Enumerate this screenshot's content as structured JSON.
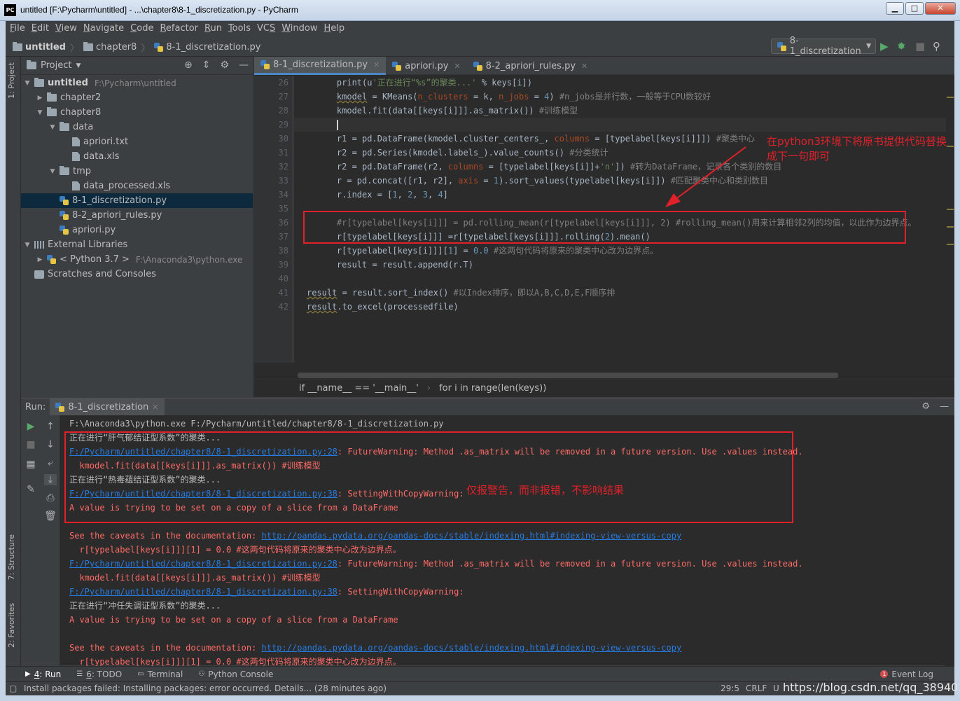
{
  "window": {
    "title": "untitled [F:\\Pycharm\\untitled] - ...\\chapter8\\8-1_discretization.py - PyCharm",
    "logo": "PC",
    "buttons": {
      "minimize": "▁",
      "maximize": "□",
      "close": "✕"
    }
  },
  "menu": [
    "File",
    "Edit",
    "View",
    "Navigate",
    "Code",
    "Refactor",
    "Run",
    "Tools",
    "VCS",
    "Window",
    "Help"
  ],
  "menu_mnemonics": [
    "F",
    "E",
    "V",
    "N",
    "C",
    "R",
    "R",
    "T",
    "S",
    "W",
    "H"
  ],
  "nav": {
    "crumbs": [
      "untitled",
      "chapter8",
      "8-1_discretization.py"
    ],
    "run_config": "8-1_discretization",
    "icons": [
      "run-icon",
      "debug-icon",
      "stop-icon",
      "search-icon"
    ]
  },
  "left_strip": {
    "project_tab": "1: Project",
    "structure_tab": "7: Structure",
    "favorites_tab": "2: Favorites"
  },
  "project": {
    "header": "Project",
    "tree": [
      {
        "label": "untitled",
        "path": "F:\\Pycharm\\untitled",
        "level": 0,
        "type": "folder",
        "expanded": true,
        "bold": true
      },
      {
        "label": "chapter2",
        "level": 1,
        "type": "folder",
        "expanded": false
      },
      {
        "label": "chapter8",
        "level": 1,
        "type": "folder",
        "expanded": true
      },
      {
        "label": "data",
        "level": 2,
        "type": "folder",
        "expanded": true
      },
      {
        "label": "apriori.txt",
        "level": 3,
        "type": "file"
      },
      {
        "label": "data.xls",
        "level": 3,
        "type": "file"
      },
      {
        "label": "tmp",
        "level": 2,
        "type": "folder",
        "expanded": true
      },
      {
        "label": "data_processed.xls",
        "level": 3,
        "type": "file"
      },
      {
        "label": "8-1_discretization.py",
        "level": 2,
        "type": "py",
        "selected": true
      },
      {
        "label": "8-2_apriori_rules.py",
        "level": 2,
        "type": "py"
      },
      {
        "label": "apriori.py",
        "level": 2,
        "type": "py"
      },
      {
        "label": "External Libraries",
        "level": 0,
        "type": "lib",
        "expanded": true
      },
      {
        "label": "< Python 3.7 >",
        "path": "F:\\Anaconda3\\python.exe",
        "level": 1,
        "type": "pyenv",
        "expanded": false
      },
      {
        "label": "Scratches and Consoles",
        "level": 0,
        "type": "scratch"
      }
    ]
  },
  "editor": {
    "tabs": [
      {
        "label": "8-1_discretization.py",
        "active": true
      },
      {
        "label": "apriori.py",
        "active": false
      },
      {
        "label": "8-2_apriori_rules.py",
        "active": false
      }
    ],
    "line_numbers": [
      "26",
      "27",
      "28",
      "29",
      "30",
      "31",
      "32",
      "33",
      "34",
      "35",
      "36",
      "37",
      "38",
      "39",
      "40",
      "41",
      "42"
    ],
    "breadcrumb": [
      "if __name__ == '__main__'",
      "for i in range(len(keys))"
    ]
  },
  "annotations": {
    "editor_note_line1": "在python3环境下将原书提供代码替换",
    "editor_note_line2": "成下一句即可",
    "console_note": "仅报警告，而非报错，不影响结果"
  },
  "run": {
    "label": "Run:",
    "tab": "8-1_discretization",
    "output": [
      {
        "text": "F:\\Anaconda3\\python.exe F:/Pycharm/untitled/chapter8/8-1_discretization.py",
        "kind": "normal"
      },
      {
        "text": "正在进行“肝气郁结证型系数”的聚类...",
        "kind": "normal"
      },
      {
        "link": "F:/Pycharm/untitled/chapter8/8-1_discretization.py:28",
        "text": ": FutureWarning: Method .as_matrix will be removed in a future version. Use .values instead.",
        "kind": "err"
      },
      {
        "text": "  kmodel.fit(data[[keys[i]]].as_matrix()) #训练模型",
        "kind": "err"
      },
      {
        "text": "正在进行“热毒蕴结证型系数”的聚类...",
        "kind": "normal"
      },
      {
        "link": "F:/Pycharm/untitled/chapter8/8-1_discretization.py:38",
        "text": ": SettingWithCopyWarning:",
        "kind": "err"
      },
      {
        "text": "A value is trying to be set on a copy of a slice from a DataFrame",
        "kind": "err"
      },
      {
        "text": "",
        "kind": "err"
      },
      {
        "text": "See the caveats in the documentation: ",
        "link2": "http://pandas.pydata.org/pandas-docs/stable/indexing.html#indexing-view-versus-copy",
        "kind": "err"
      },
      {
        "text": "  r[typelabel[keys[i]]][1] = 0.0 #这两句代码将原来的聚类中心改为边界点。",
        "kind": "err"
      },
      {
        "link": "F:/Pycharm/untitled/chapter8/8-1_discretization.py:28",
        "text": ": FutureWarning: Method .as_matrix will be removed in a future version. Use .values instead.",
        "kind": "err"
      },
      {
        "text": "  kmodel.fit(data[[keys[i]]].as_matrix()) #训练模型",
        "kind": "err"
      },
      {
        "link": "F:/Pycharm/untitled/chapter8/8-1_discretization.py:38",
        "text": ": SettingWithCopyWarning:",
        "kind": "err"
      },
      {
        "text": "正在进行“冲任失调证型系数”的聚类...",
        "kind": "normal"
      },
      {
        "text": "A value is trying to be set on a copy of a slice from a DataFrame",
        "kind": "err"
      },
      {
        "text": "",
        "kind": "err"
      },
      {
        "text": "See the caveats in the documentation: ",
        "link2": "http://pandas.pydata.org/pandas-docs/stable/indexing.html#indexing-view-versus-copy",
        "kind": "err"
      },
      {
        "text": "  r[typelabel[keys[i]]][1] = 0.0 #这两句代码将原来的聚类中心改为边界点。",
        "kind": "err"
      }
    ]
  },
  "bottom_tabs": [
    {
      "label": "4: Run",
      "mnemonic": "4",
      "active": true
    },
    {
      "label": "6: TODO",
      "mnemonic": "6",
      "active": false
    },
    {
      "label": "Terminal",
      "active": false
    },
    {
      "label": "Python Console",
      "active": false
    }
  ],
  "event_log": {
    "label": "Event Log",
    "count": "1"
  },
  "status": {
    "message": "Install packages failed: Installing packages: error occurred. Details... (28 minutes ago)",
    "position": "29:5",
    "line_ending": "CRLF",
    "encoding": "U",
    "watermark": "https://blog.csdn.net/qq_38940390"
  }
}
